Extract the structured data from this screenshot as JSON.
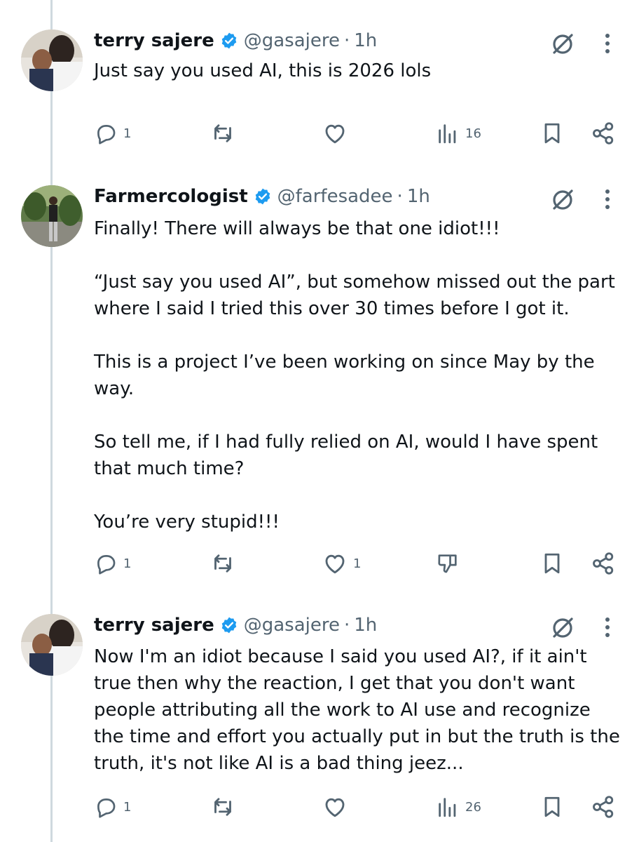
{
  "tweets": [
    {
      "name": "terry sajere",
      "handle": "@gasajere",
      "separator": "·",
      "time": "1h",
      "lines": [
        "Just say you used AI, this is 2026 lols"
      ],
      "reply_count": "1",
      "repost_count": "",
      "like_count": "",
      "view_count": "16"
    },
    {
      "name": "Farmercologist",
      "handle": "@farfesadee",
      "separator": "·",
      "time": "1h",
      "paragraphs": [
        [
          "Finally! There will always be that one idiot!!!"
        ],
        [
          "“Just say you used AI”, but somehow missed out the part",
          "where I said I tried this over 30 times before I got it."
        ],
        [
          "This is a project I’ve been working on since May by the",
          "way."
        ],
        [
          "So tell me, if I had fully relied on AI, would I have spent",
          "that much time?"
        ],
        [
          "You’re very stupid!!!"
        ]
      ],
      "reply_count": "1",
      "repost_count": "",
      "like_count": "1"
    },
    {
      "name": "terry sajere",
      "handle": "@gasajere",
      "separator": "·",
      "time": "1h",
      "lines": [
        "Now I'm an idiot because I said you used AI?, if it ain't",
        "true then why the reaction, I get that you don't want",
        "people attributing all the work to AI use and recognize",
        "the time and effort you actually put in but the truth is the",
        "truth, it's not like AI is a bad thing jeez..."
      ],
      "reply_count": "1",
      "repost_count": "",
      "like_count": "",
      "view_count": "26"
    }
  ],
  "colors": {
    "text": "#0f1419",
    "secondary": "#536471",
    "verified": "#1d9bf0",
    "thread_line": "#cfd9de"
  },
  "icons": [
    "verified-badge-icon",
    "grok-icon",
    "more-vertical-icon",
    "reply-icon",
    "repost-icon",
    "like-icon",
    "views-icon",
    "dislike-icon",
    "bookmark-icon",
    "share-icon"
  ]
}
